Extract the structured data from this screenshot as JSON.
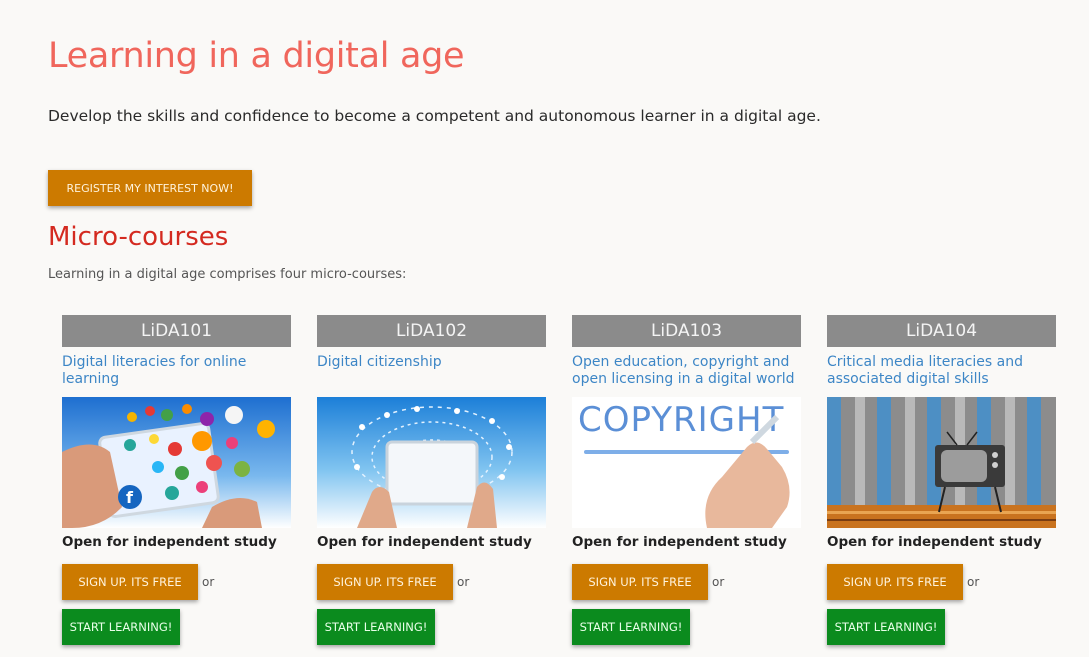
{
  "header": {
    "title": "Learning in a digital age",
    "subtitle": "Develop the skills and confidence to become a competent and autonomous learner in a digital age.",
    "register_label": "REGISTER MY INTEREST NOW!"
  },
  "section": {
    "title": "Micro-courses",
    "intro": "Learning in a digital age comprises four micro-courses:"
  },
  "courses": [
    {
      "code": "LiDA101",
      "title": "Digital literacies for online learning",
      "status": "Open for independent study",
      "signup_label": "SIGN UP. ITS FREE",
      "or_label": "or",
      "start_label": "START LEARNING!"
    },
    {
      "code": "LiDA102",
      "title": "Digital citizenship",
      "status": "Open for independent study",
      "signup_label": "SIGN UP. ITS FREE",
      "or_label": "or",
      "start_label": "START LEARNING!"
    },
    {
      "code": "LiDA103",
      "title": "Open education, copyright and open licensing in a digital world",
      "status": "Open for independent study",
      "signup_label": "SIGN UP. ITS FREE",
      "or_label": "or",
      "start_label": "START LEARNING!",
      "image_text": "COPYRIGHT"
    },
    {
      "code": "LiDA104",
      "title": "Critical media literacies and associated digital skills",
      "status": "Open for independent study",
      "signup_label": "SIGN UP. ITS FREE",
      "or_label": "or",
      "start_label": "START LEARNING!"
    }
  ],
  "colors": {
    "title": "#f0665c",
    "section_title": "#d42a20",
    "link": "#3d86c6",
    "orange_button": "#cc7a00",
    "green_button": "#0b8b1e",
    "code_bar": "#8b8b8b"
  }
}
